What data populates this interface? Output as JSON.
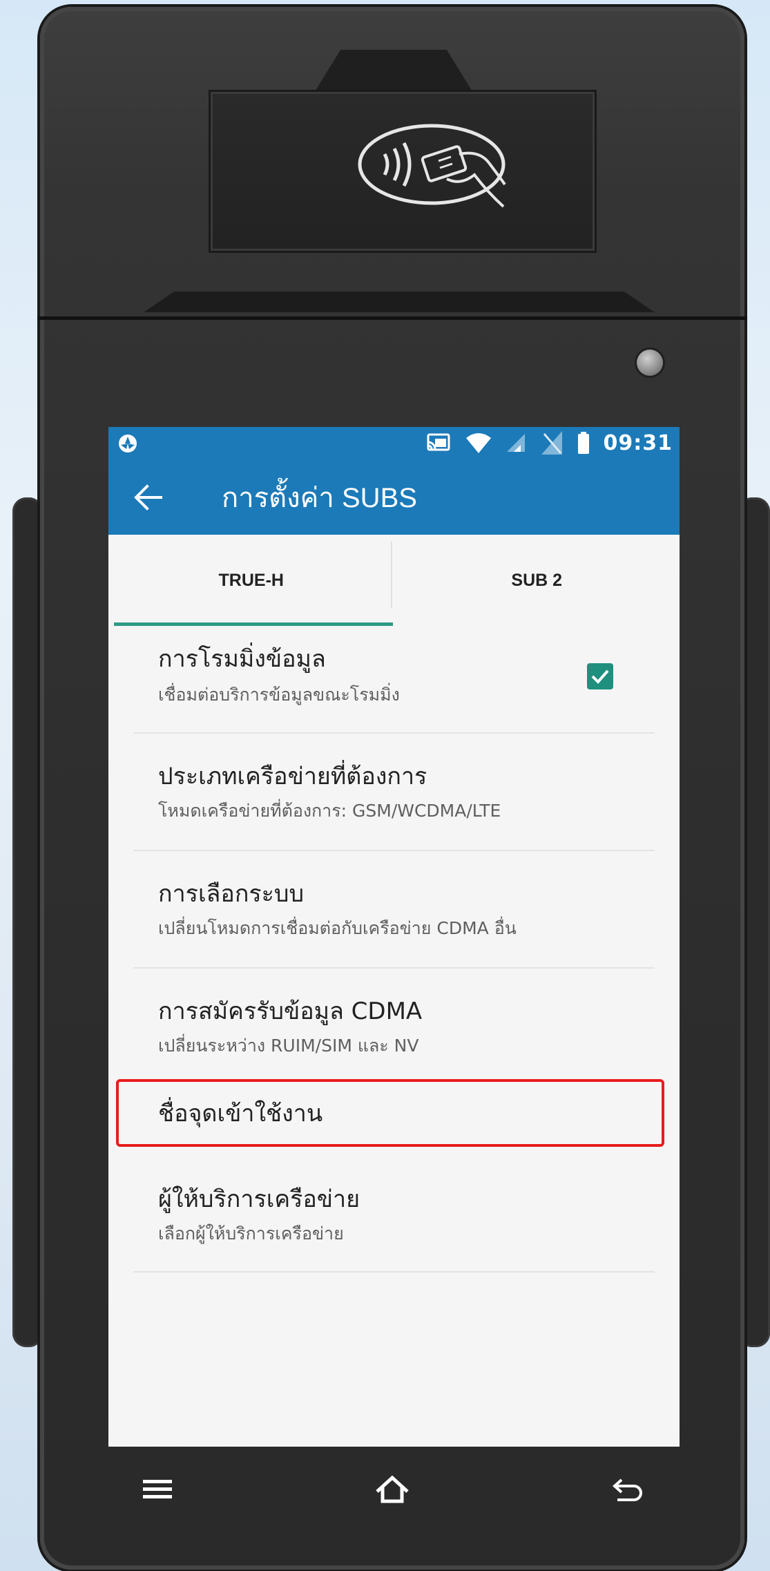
{
  "status_bar": {
    "time": "09:31",
    "icons": [
      "app-notification-icon",
      "cast-icon",
      "wifi-icon",
      "cell-signal-icon",
      "no-sim-icon",
      "battery-icon"
    ]
  },
  "app_bar": {
    "title": "การตั้งค่า SUBS",
    "back_icon": "back-arrow-icon"
  },
  "tabs": [
    {
      "label": "TRUE-H",
      "selected": true
    },
    {
      "label": "SUB 2",
      "selected": false
    }
  ],
  "settings": [
    {
      "title": "การโรมมิ่งข้อมูล",
      "summary": "เชื่อมต่อบริการข้อมูลขณะโรมมิ่ง",
      "checked": true
    },
    {
      "title": "ประเภทเครือข่ายที่ต้องการ",
      "summary": "โหมดเครือข่ายที่ต้องการ: GSM/WCDMA/LTE"
    },
    {
      "title": "การเลือกระบบ",
      "summary": "เปลี่ยนโหมดการเชื่อมต่อกับเครือข่าย CDMA อื่น"
    },
    {
      "title": "การสมัครรับข้อมูล CDMA",
      "summary": "เปลี่ยนระหว่าง RUIM/SIM และ NV"
    },
    {
      "title": "ชื่อจุดเข้าใช้งาน",
      "highlighted": true
    },
    {
      "title": "ผู้ให้บริการเครือข่าย",
      "summary": "เลือกผู้ให้บริการเครือข่าย"
    }
  ],
  "colors": {
    "primary": "#1c7ab8",
    "accent": "#2e9a86",
    "highlight": "#e81c1c"
  },
  "nav_buttons": [
    "menu-icon",
    "home-icon",
    "back-icon"
  ]
}
